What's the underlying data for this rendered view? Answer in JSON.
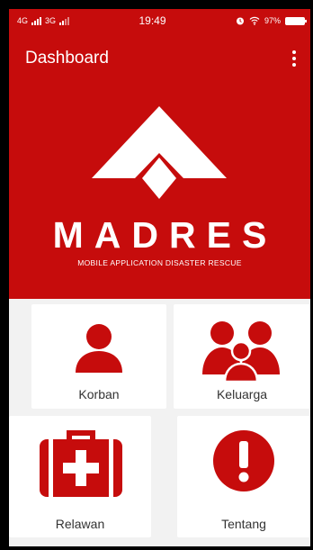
{
  "statusbar": {
    "network1": "4G",
    "network2": "3G",
    "time": "19:49",
    "battery": "97%",
    "icons": [
      "alarm-icon",
      "wifi-icon",
      "battery-icon"
    ]
  },
  "appbar": {
    "title": "Dashboard",
    "menu_icon": "more-vert-icon"
  },
  "hero": {
    "logo_icon": "madres-logo-icon",
    "brand": "MADRES",
    "tagline": "MOBILE APPLICATION DISASTER RESCUE"
  },
  "menu": [
    {
      "label": "Korban",
      "icon": "person-icon"
    },
    {
      "label": "Keluarga",
      "icon": "family-icon"
    },
    {
      "label": "Relawan",
      "icon": "first-aid-kit-icon"
    },
    {
      "label": "Tentang",
      "icon": "info-alert-icon"
    }
  ],
  "colors": {
    "primary": "#c60c0c",
    "background": "#f2f2f2",
    "card": "#ffffff"
  }
}
